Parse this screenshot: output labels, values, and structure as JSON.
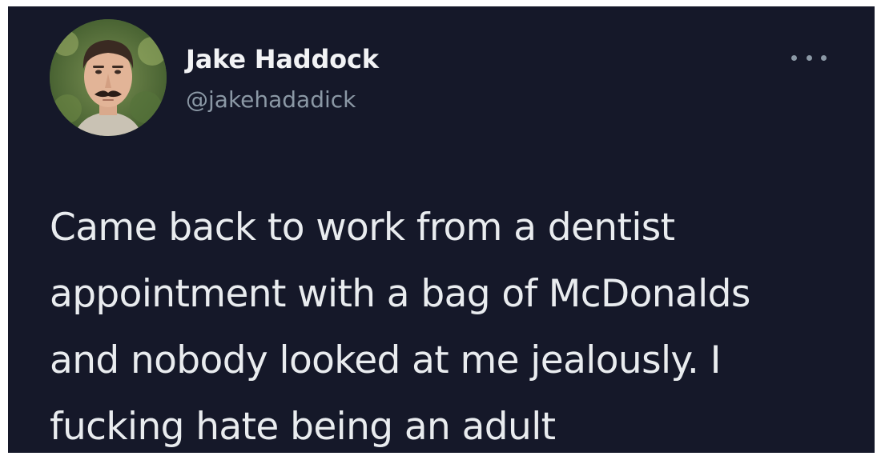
{
  "tweet": {
    "author_name": "Jake Haddock",
    "author_handle": "@jakehadadick",
    "text": "Came back to work from a dentist\nappointment with a bag of McDonalds\nand nobody looked at me jealously. I\nfucking hate being an adult",
    "more_icon": "more-horizontal-icon",
    "avatar": "avatar-photo"
  },
  "colors": {
    "background": "#151829",
    "name": "#f2f3f5",
    "handle": "#8b98a5",
    "text": "#e9ecef"
  }
}
